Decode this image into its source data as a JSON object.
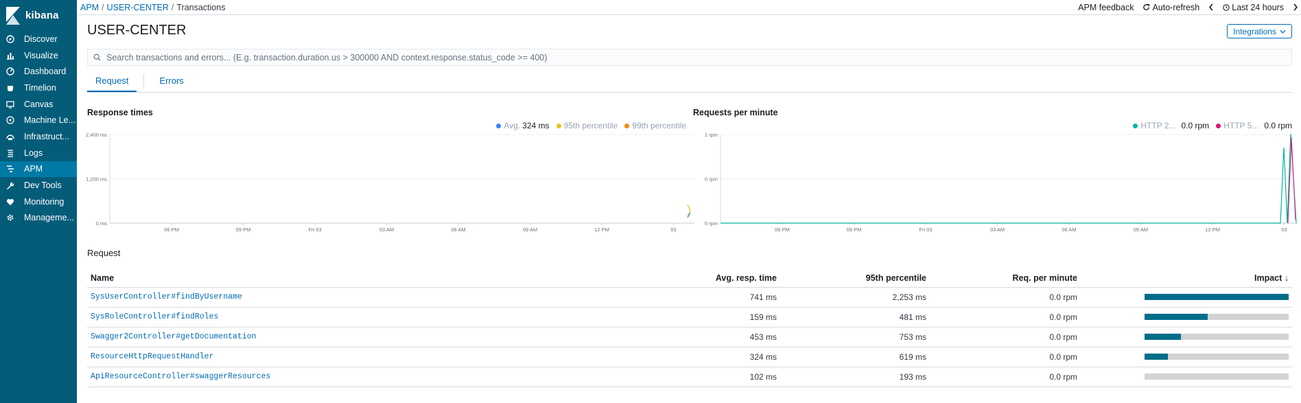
{
  "app": {
    "name": "kibana"
  },
  "nav": {
    "items": [
      {
        "label": "Discover",
        "icon": "compass-icon",
        "active": false
      },
      {
        "label": "Visualize",
        "icon": "bar-chart-icon",
        "active": false
      },
      {
        "label": "Dashboard",
        "icon": "dashboard-icon",
        "active": false
      },
      {
        "label": "Timelion",
        "icon": "timelion-icon",
        "active": false
      },
      {
        "label": "Canvas",
        "icon": "canvas-icon",
        "active": false
      },
      {
        "label": "Machine Le...",
        "icon": "machine-learning-icon",
        "active": false
      },
      {
        "label": "Infrastruct...",
        "icon": "infrastructure-icon",
        "active": false
      },
      {
        "label": "Logs",
        "icon": "logs-icon",
        "active": false
      },
      {
        "label": "APM",
        "icon": "apm-icon",
        "active": true
      },
      {
        "label": "Dev Tools",
        "icon": "wrench-icon",
        "active": false
      },
      {
        "label": "Monitoring",
        "icon": "heartbeat-icon",
        "active": false
      },
      {
        "label": "Manageme...",
        "icon": "gear-icon",
        "active": false
      }
    ]
  },
  "breadcrumb": {
    "apm": "APM",
    "service": "USER-CENTER",
    "current": "Transactions",
    "sep": "/"
  },
  "topbar": {
    "feedback": "APM feedback",
    "refresh": "Auto-refresh",
    "time": "Last 24 hours"
  },
  "page": {
    "title": "USER-CENTER",
    "integrations": "Integrations"
  },
  "search": {
    "placeholder": "Search transactions and errors... (E.g. transaction.duration.us > 300000 AND context.response.status_code >= 400)"
  },
  "tabs": {
    "request": "Request",
    "errors": "Errors"
  },
  "colors": {
    "avg": "#3185fc",
    "p95": "#e6c220",
    "p99": "#f98510",
    "http2": "#00b3a4",
    "http5": "#db1374",
    "bar": "#006e8a"
  },
  "chart_data": [
    {
      "type": "line",
      "title": "Response times",
      "legend": [
        {
          "name": "Avg.",
          "value": "324 ms"
        },
        {
          "name": "95th percentile",
          "value": ""
        },
        {
          "name": "99th percentile",
          "value": ""
        }
      ],
      "x_ticks": [
        "06 PM",
        "09 PM",
        "Fri 03",
        "03 AM",
        "06 AM",
        "09 AM",
        "12 PM",
        "03"
      ],
      "y_ticks": [
        "2,400 ms",
        "1,200 ms",
        "0 ms"
      ],
      "ylim": [
        0,
        2400
      ],
      "grid": true,
      "legend_position": "top-right"
    },
    {
      "type": "line",
      "title": "Requests per minute",
      "legend": [
        {
          "name": "HTTP 2...",
          "value": "0.0 rpm"
        },
        {
          "name": "HTTP 5...",
          "value": "0.0 rpm"
        }
      ],
      "x_ticks": [
        "06 PM",
        "09 PM",
        "Fri 03",
        "03 AM",
        "06 AM",
        "09 AM",
        "12 PM",
        "03"
      ],
      "y_ticks": [
        "1 rpm",
        "0 rpm",
        "0 rpm"
      ],
      "grid": true,
      "legend_position": "top-right"
    }
  ],
  "table": {
    "section_title": "Request",
    "headers": {
      "name": "Name",
      "avg": "Avg. resp. time",
      "p95": "95th percentile",
      "rpm": "Req. per minute",
      "impact": "Impact ↓"
    },
    "rows": [
      {
        "name": "SysUserController#findByUsername",
        "avg": "741 ms",
        "p95": "2,253 ms",
        "rpm": "0.0 rpm",
        "impact": 1.0
      },
      {
        "name": "SysRoleController#findRoles",
        "avg": "159 ms",
        "p95": "481 ms",
        "rpm": "0.0 rpm",
        "impact": 0.44
      },
      {
        "name": "Swagger2Controller#getDocumentation",
        "avg": "453 ms",
        "p95": "753 ms",
        "rpm": "0.0 rpm",
        "impact": 0.25
      },
      {
        "name": "ResourceHttpRequestHandler",
        "avg": "324 ms",
        "p95": "619 ms",
        "rpm": "0.0 rpm",
        "impact": 0.16
      },
      {
        "name": "ApiResourceController#swaggerResources",
        "avg": "102 ms",
        "p95": "193 ms",
        "rpm": "0.0 rpm",
        "impact": 0.0
      }
    ]
  }
}
